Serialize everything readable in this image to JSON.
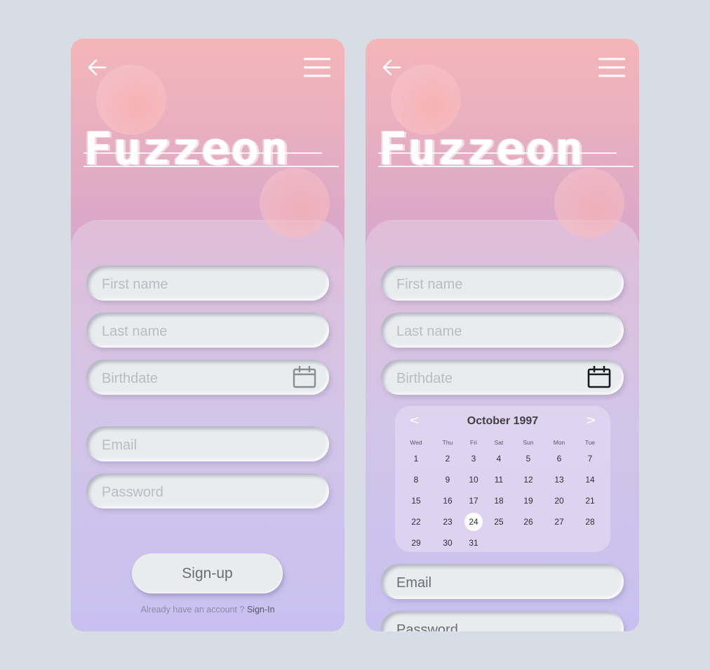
{
  "app": {
    "logo": "Fuzzeon"
  },
  "form": {
    "first_name_placeholder": "First name",
    "last_name_placeholder": "Last name",
    "birthdate_placeholder": "Birthdate",
    "email_placeholder": "Email",
    "password_placeholder": "Password",
    "signup_label": "Sign-up",
    "have_account_text": "Already have an account ?",
    "signin_link": "Sign-In"
  },
  "calendar": {
    "month_title": "October 1997",
    "prev": "<",
    "next": ">",
    "weekdays": [
      "Wed",
      "Thu",
      "Fri",
      "Sat",
      "Sun",
      "Mon",
      "Tue"
    ],
    "days": [
      [
        "1",
        "2",
        "3",
        "4",
        "5",
        "6",
        "7"
      ],
      [
        "8",
        "9",
        "10",
        "11",
        "12",
        "13",
        "14"
      ],
      [
        "15",
        "16",
        "17",
        "18",
        "19",
        "20",
        "21"
      ],
      [
        "22",
        "23",
        "24",
        "25",
        "26",
        "27",
        "28"
      ],
      [
        "29",
        "30",
        "31"
      ]
    ],
    "selected_day": "24"
  },
  "icons": {
    "back": "arrow-left-icon",
    "menu": "hamburger-menu-icon",
    "calendar": "calendar-icon"
  },
  "colors": {
    "background": "#d8dde5",
    "gradient_top": "#f4b6b8",
    "gradient_bottom": "#b5acee",
    "field": "#e9ecef",
    "bubble": "#f8b2b2"
  }
}
